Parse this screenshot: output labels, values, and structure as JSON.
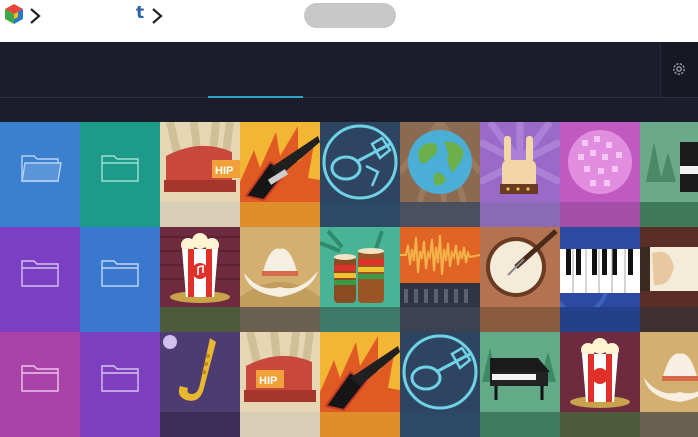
{
  "topbar": {
    "icons": [
      "app-logo-icon",
      "chevron-right-icon",
      "t-app-icon",
      "chevron-right-icon"
    ],
    "t_label": "t"
  },
  "header": {
    "settings_icon": "gear-icon",
    "active_tab_color": "#2aa3c8",
    "background": "#1b1e2a"
  },
  "grid": {
    "folders": [
      {
        "icon": "folder-open-icon",
        "color": "#3b7fcf"
      },
      {
        "icon": "folder-icon",
        "color": "#1e9a8a"
      },
      {
        "icon": "folder-icon",
        "color": "#7a3fc2"
      },
      {
        "icon": "folder-icon",
        "color": "#3a77cf"
      },
      {
        "icon": "folder-icon",
        "color": "#a943a8"
      },
      {
        "icon": "folder-icon",
        "color": "#7d3fbd"
      }
    ],
    "artwork": [
      "hip-hop-cap-artwork",
      "electric-guitar-artwork",
      "acoustic-guitar-artwork",
      "world-globe-artwork",
      "rock-hand-artwork",
      "disco-ball-artwork",
      "piano-artwork",
      "popcorn-artwork",
      "cowboy-hat-artwork",
      "bongo-drums-artwork",
      "waveform-artwork",
      "banjo-artwork",
      "keyboard-artwork",
      "guitar-hand-artwork",
      "saxophone-artwork",
      "hip-hop-cap-artwork",
      "electric-guitar-artwork",
      "acoustic-guitar-artwork",
      "grand-piano-artwork",
      "popcorn-artwork",
      "cowboy-hat-artwork"
    ],
    "text": {
      "hip": "HIP"
    }
  }
}
